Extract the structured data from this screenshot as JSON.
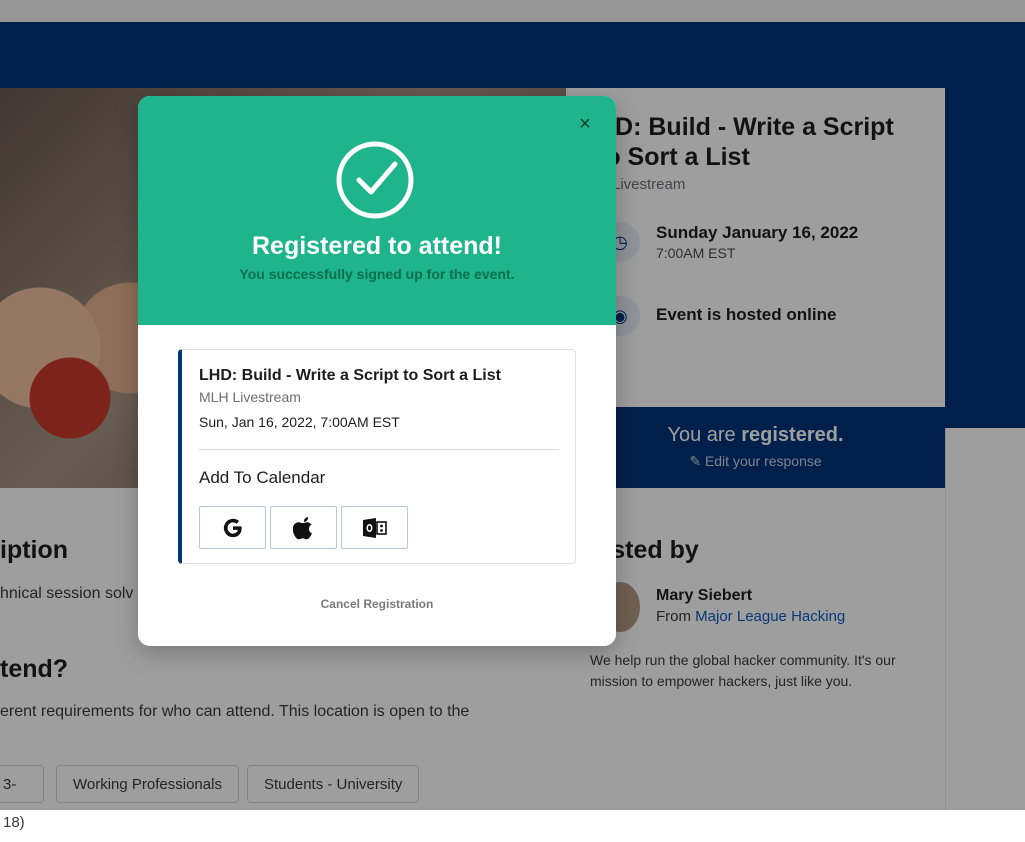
{
  "event": {
    "title": "LHD: Build - Write a Script to Sort a List",
    "title_visible": "HD: Build - Write a Script to Sort a List",
    "host_visible": "H Livestream",
    "date": "Sunday January 16, 2022",
    "time": "7:00AM EST",
    "location": "Event is hosted online"
  },
  "registration": {
    "status_prefix": "You are ",
    "status_strong": "registered.",
    "edit_label": "Edit your response",
    "edit_icon": "pencil-square-icon"
  },
  "sections": {
    "description_heading": "iption",
    "description_text": "hnical session solv",
    "attend_heading": "tend?",
    "attend_text": "erent requirements for who can attend. This location is open to the",
    "hosted_heading": "osted by"
  },
  "tags": [
    "3-18)",
    "Working Professionals",
    "Students - University"
  ],
  "host": {
    "name": "Mary Siebert",
    "from_prefix": "From ",
    "org": "Major League Hacking",
    "bio": "We help run the global hacker community. It's our mission to empower hackers, just like you."
  },
  "modal": {
    "close_label": "×",
    "icon": "check-circle-icon",
    "title": "Registered to attend!",
    "subtitle": "You successfully signed up for the event.",
    "card": {
      "title": "LHD: Build - Write a Script to Sort a List",
      "host": "MLH Livestream",
      "date": "Sun, Jan 16, 2022, 7:00AM EST",
      "add_to_calendar": "Add To Calendar",
      "calendar_buttons": [
        {
          "icon": "google-icon"
        },
        {
          "icon": "apple-icon"
        },
        {
          "icon": "outlook-icon"
        }
      ]
    },
    "cancel_label": "Cancel Registration"
  },
  "colors": {
    "brand_blue": "#00357a",
    "success_green": "#1eb48c",
    "link": "#0b5cc1"
  }
}
